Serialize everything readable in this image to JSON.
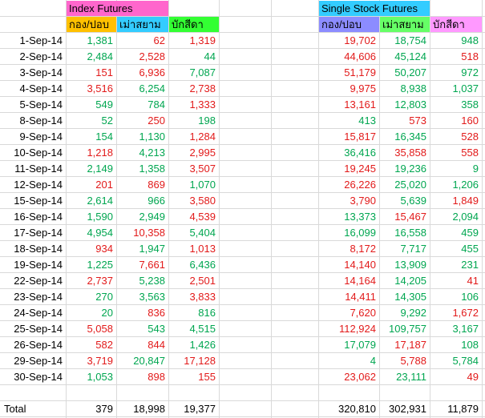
{
  "headers": {
    "index_title": "Index Futures",
    "single_title": "Single Stock Futures",
    "col1": "กอง/ปอบ",
    "col2": "เม่าสยาม",
    "col3": "บักสีดา"
  },
  "colors": {
    "index_title_bg": "#ff66cc",
    "single_title_bg": "#33ccff",
    "idx_col1_bg": "#ffc000",
    "idx_col2_bg": "#33ccff",
    "idx_col3_bg": "#33ff33",
    "ss_col1_bg": "#8c8cff",
    "ss_col2_bg": "#66ff66",
    "ss_col3_bg": "#ff99ff",
    "positive": "#00a650",
    "negative": "#e21a1a"
  },
  "rows": [
    {
      "date": "1-Sep-14",
      "i": [
        [
          "1,381",
          "g"
        ],
        [
          "62",
          "r"
        ],
        [
          "1,319",
          "r"
        ]
      ],
      "s": [
        [
          "19,702",
          "r"
        ],
        [
          "18,754",
          "g"
        ],
        [
          "948",
          "g"
        ]
      ]
    },
    {
      "date": "2-Sep-14",
      "i": [
        [
          "2,484",
          "g"
        ],
        [
          "2,528",
          "r"
        ],
        [
          "44",
          "g"
        ]
      ],
      "s": [
        [
          "44,606",
          "r"
        ],
        [
          "45,124",
          "g"
        ],
        [
          "518",
          "r"
        ]
      ]
    },
    {
      "date": "3-Sep-14",
      "i": [
        [
          "151",
          "r"
        ],
        [
          "6,936",
          "r"
        ],
        [
          "7,087",
          "g"
        ]
      ],
      "s": [
        [
          "51,179",
          "r"
        ],
        [
          "50,207",
          "g"
        ],
        [
          "972",
          "g"
        ]
      ]
    },
    {
      "date": "4-Sep-14",
      "i": [
        [
          "3,516",
          "r"
        ],
        [
          "6,254",
          "g"
        ],
        [
          "2,738",
          "r"
        ]
      ],
      "s": [
        [
          "9,975",
          "r"
        ],
        [
          "8,938",
          "g"
        ],
        [
          "1,037",
          "g"
        ]
      ]
    },
    {
      "date": "5-Sep-14",
      "i": [
        [
          "549",
          "g"
        ],
        [
          "784",
          "g"
        ],
        [
          "1,333",
          "r"
        ]
      ],
      "s": [
        [
          "13,161",
          "r"
        ],
        [
          "12,803",
          "g"
        ],
        [
          "358",
          "g"
        ]
      ]
    },
    {
      "date": "8-Sep-14",
      "i": [
        [
          "52",
          "g"
        ],
        [
          "250",
          "r"
        ],
        [
          "198",
          "g"
        ]
      ],
      "s": [
        [
          "413",
          "g"
        ],
        [
          "573",
          "r"
        ],
        [
          "160",
          "r"
        ]
      ]
    },
    {
      "date": "9-Sep-14",
      "i": [
        [
          "154",
          "g"
        ],
        [
          "1,130",
          "g"
        ],
        [
          "1,284",
          "r"
        ]
      ],
      "s": [
        [
          "15,817",
          "r"
        ],
        [
          "16,345",
          "g"
        ],
        [
          "528",
          "r"
        ]
      ]
    },
    {
      "date": "10-Sep-14",
      "i": [
        [
          "1,218",
          "r"
        ],
        [
          "4,213",
          "g"
        ],
        [
          "2,995",
          "r"
        ]
      ],
      "s": [
        [
          "36,416",
          "g"
        ],
        [
          "35,858",
          "r"
        ],
        [
          "558",
          "r"
        ]
      ]
    },
    {
      "date": "11-Sep-14",
      "i": [
        [
          "2,149",
          "g"
        ],
        [
          "1,358",
          "g"
        ],
        [
          "3,507",
          "r"
        ]
      ],
      "s": [
        [
          "19,245",
          "r"
        ],
        [
          "19,236",
          "g"
        ],
        [
          "9",
          "g"
        ]
      ]
    },
    {
      "date": "12-Sep-14",
      "i": [
        [
          "201",
          "r"
        ],
        [
          "869",
          "r"
        ],
        [
          "1,070",
          "g"
        ]
      ],
      "s": [
        [
          "26,226",
          "r"
        ],
        [
          "25,020",
          "g"
        ],
        [
          "1,206",
          "g"
        ]
      ]
    },
    {
      "date": "15-Sep-14",
      "i": [
        [
          "2,614",
          "g"
        ],
        [
          "966",
          "g"
        ],
        [
          "3,580",
          "r"
        ]
      ],
      "s": [
        [
          "3,790",
          "r"
        ],
        [
          "5,639",
          "g"
        ],
        [
          "1,849",
          "r"
        ]
      ]
    },
    {
      "date": "16-Sep-14",
      "i": [
        [
          "1,590",
          "g"
        ],
        [
          "2,949",
          "g"
        ],
        [
          "4,539",
          "r"
        ]
      ],
      "s": [
        [
          "13,373",
          "g"
        ],
        [
          "15,467",
          "r"
        ],
        [
          "2,094",
          "g"
        ]
      ]
    },
    {
      "date": "17-Sep-14",
      "i": [
        [
          "4,954",
          "g"
        ],
        [
          "10,358",
          "r"
        ],
        [
          "5,404",
          "g"
        ]
      ],
      "s": [
        [
          "16,099",
          "g"
        ],
        [
          "16,558",
          "g"
        ],
        [
          "459",
          "g"
        ]
      ]
    },
    {
      "date": "18-Sep-14",
      "i": [
        [
          "934",
          "r"
        ],
        [
          "1,947",
          "g"
        ],
        [
          "1,013",
          "r"
        ]
      ],
      "s": [
        [
          "8,172",
          "r"
        ],
        [
          "7,717",
          "g"
        ],
        [
          "455",
          "g"
        ]
      ]
    },
    {
      "date": "19-Sep-14",
      "i": [
        [
          "1,225",
          "g"
        ],
        [
          "7,661",
          "r"
        ],
        [
          "6,436",
          "g"
        ]
      ],
      "s": [
        [
          "14,140",
          "r"
        ],
        [
          "13,909",
          "g"
        ],
        [
          "231",
          "g"
        ]
      ]
    },
    {
      "date": "22-Sep-14",
      "i": [
        [
          "2,737",
          "r"
        ],
        [
          "5,238",
          "g"
        ],
        [
          "2,501",
          "r"
        ]
      ],
      "s": [
        [
          "14,164",
          "r"
        ],
        [
          "14,205",
          "g"
        ],
        [
          "41",
          "r"
        ]
      ]
    },
    {
      "date": "23-Sep-14",
      "i": [
        [
          "270",
          "g"
        ],
        [
          "3,563",
          "g"
        ],
        [
          "3,833",
          "r"
        ]
      ],
      "s": [
        [
          "14,411",
          "r"
        ],
        [
          "14,305",
          "g"
        ],
        [
          "106",
          "g"
        ]
      ]
    },
    {
      "date": "24-Sep-14",
      "i": [
        [
          "20",
          "g"
        ],
        [
          "836",
          "r"
        ],
        [
          "816",
          "g"
        ]
      ],
      "s": [
        [
          "7,620",
          "r"
        ],
        [
          "9,292",
          "g"
        ],
        [
          "1,672",
          "r"
        ]
      ]
    },
    {
      "date": "25-Sep-14",
      "i": [
        [
          "5,058",
          "r"
        ],
        [
          "543",
          "g"
        ],
        [
          "4,515",
          "g"
        ]
      ],
      "s": [
        [
          "112,924",
          "r"
        ],
        [
          "109,757",
          "g"
        ],
        [
          "3,167",
          "g"
        ]
      ]
    },
    {
      "date": "26-Sep-14",
      "i": [
        [
          "582",
          "r"
        ],
        [
          "844",
          "r"
        ],
        [
          "1,426",
          "g"
        ]
      ],
      "s": [
        [
          "17,079",
          "g"
        ],
        [
          "17,187",
          "r"
        ],
        [
          "108",
          "g"
        ]
      ]
    },
    {
      "date": "29-Sep-14",
      "i": [
        [
          "3,719",
          "r"
        ],
        [
          "20,847",
          "g"
        ],
        [
          "17,128",
          "r"
        ]
      ],
      "s": [
        [
          "4",
          "g"
        ],
        [
          "5,788",
          "r"
        ],
        [
          "5,784",
          "g"
        ]
      ]
    },
    {
      "date": "30-Sep-14",
      "i": [
        [
          "1,053",
          "g"
        ],
        [
          "898",
          "r"
        ],
        [
          "155",
          "r"
        ]
      ],
      "s": [
        [
          "23,062",
          "r"
        ],
        [
          "23,111",
          "g"
        ],
        [
          "49",
          "r"
        ]
      ]
    }
  ],
  "total": {
    "label": "Total",
    "i": [
      "379",
      "18,998",
      "19,377"
    ],
    "s": [
      "320,810",
      "302,931",
      "11,879"
    ]
  }
}
